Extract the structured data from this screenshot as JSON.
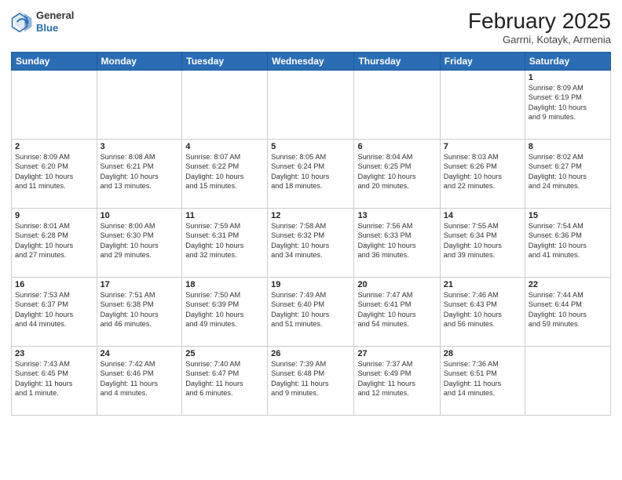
{
  "header": {
    "logo_line1": "General",
    "logo_line2": "Blue",
    "month_title": "February 2025",
    "location": "Garrni, Kotayk, Armenia"
  },
  "weekdays": [
    "Sunday",
    "Monday",
    "Tuesday",
    "Wednesday",
    "Thursday",
    "Friday",
    "Saturday"
  ],
  "weeks": [
    [
      {
        "day": "",
        "info": ""
      },
      {
        "day": "",
        "info": ""
      },
      {
        "day": "",
        "info": ""
      },
      {
        "day": "",
        "info": ""
      },
      {
        "day": "",
        "info": ""
      },
      {
        "day": "",
        "info": ""
      },
      {
        "day": "1",
        "info": "Sunrise: 8:09 AM\nSunset: 6:19 PM\nDaylight: 10 hours\nand 9 minutes."
      }
    ],
    [
      {
        "day": "2",
        "info": "Sunrise: 8:09 AM\nSunset: 6:20 PM\nDaylight: 10 hours\nand 11 minutes."
      },
      {
        "day": "3",
        "info": "Sunrise: 8:08 AM\nSunset: 6:21 PM\nDaylight: 10 hours\nand 13 minutes."
      },
      {
        "day": "4",
        "info": "Sunrise: 8:07 AM\nSunset: 6:22 PM\nDaylight: 10 hours\nand 15 minutes."
      },
      {
        "day": "5",
        "info": "Sunrise: 8:05 AM\nSunset: 6:24 PM\nDaylight: 10 hours\nand 18 minutes."
      },
      {
        "day": "6",
        "info": "Sunrise: 8:04 AM\nSunset: 6:25 PM\nDaylight: 10 hours\nand 20 minutes."
      },
      {
        "day": "7",
        "info": "Sunrise: 8:03 AM\nSunset: 6:26 PM\nDaylight: 10 hours\nand 22 minutes."
      },
      {
        "day": "8",
        "info": "Sunrise: 8:02 AM\nSunset: 6:27 PM\nDaylight: 10 hours\nand 24 minutes."
      }
    ],
    [
      {
        "day": "9",
        "info": "Sunrise: 8:01 AM\nSunset: 6:28 PM\nDaylight: 10 hours\nand 27 minutes."
      },
      {
        "day": "10",
        "info": "Sunrise: 8:00 AM\nSunset: 6:30 PM\nDaylight: 10 hours\nand 29 minutes."
      },
      {
        "day": "11",
        "info": "Sunrise: 7:59 AM\nSunset: 6:31 PM\nDaylight: 10 hours\nand 32 minutes."
      },
      {
        "day": "12",
        "info": "Sunrise: 7:58 AM\nSunset: 6:32 PM\nDaylight: 10 hours\nand 34 minutes."
      },
      {
        "day": "13",
        "info": "Sunrise: 7:56 AM\nSunset: 6:33 PM\nDaylight: 10 hours\nand 36 minutes."
      },
      {
        "day": "14",
        "info": "Sunrise: 7:55 AM\nSunset: 6:34 PM\nDaylight: 10 hours\nand 39 minutes."
      },
      {
        "day": "15",
        "info": "Sunrise: 7:54 AM\nSunset: 6:36 PM\nDaylight: 10 hours\nand 41 minutes."
      }
    ],
    [
      {
        "day": "16",
        "info": "Sunrise: 7:53 AM\nSunset: 6:37 PM\nDaylight: 10 hours\nand 44 minutes."
      },
      {
        "day": "17",
        "info": "Sunrise: 7:51 AM\nSunset: 6:38 PM\nDaylight: 10 hours\nand 46 minutes."
      },
      {
        "day": "18",
        "info": "Sunrise: 7:50 AM\nSunset: 6:39 PM\nDaylight: 10 hours\nand 49 minutes."
      },
      {
        "day": "19",
        "info": "Sunrise: 7:49 AM\nSunset: 6:40 PM\nDaylight: 10 hours\nand 51 minutes."
      },
      {
        "day": "20",
        "info": "Sunrise: 7:47 AM\nSunset: 6:41 PM\nDaylight: 10 hours\nand 54 minutes."
      },
      {
        "day": "21",
        "info": "Sunrise: 7:46 AM\nSunset: 6:43 PM\nDaylight: 10 hours\nand 56 minutes."
      },
      {
        "day": "22",
        "info": "Sunrise: 7:44 AM\nSunset: 6:44 PM\nDaylight: 10 hours\nand 59 minutes."
      }
    ],
    [
      {
        "day": "23",
        "info": "Sunrise: 7:43 AM\nSunset: 6:45 PM\nDaylight: 11 hours\nand 1 minute."
      },
      {
        "day": "24",
        "info": "Sunrise: 7:42 AM\nSunset: 6:46 PM\nDaylight: 11 hours\nand 4 minutes."
      },
      {
        "day": "25",
        "info": "Sunrise: 7:40 AM\nSunset: 6:47 PM\nDaylight: 11 hours\nand 6 minutes."
      },
      {
        "day": "26",
        "info": "Sunrise: 7:39 AM\nSunset: 6:48 PM\nDaylight: 11 hours\nand 9 minutes."
      },
      {
        "day": "27",
        "info": "Sunrise: 7:37 AM\nSunset: 6:49 PM\nDaylight: 11 hours\nand 12 minutes."
      },
      {
        "day": "28",
        "info": "Sunrise: 7:36 AM\nSunset: 6:51 PM\nDaylight: 11 hours\nand 14 minutes."
      },
      {
        "day": "",
        "info": ""
      }
    ]
  ]
}
